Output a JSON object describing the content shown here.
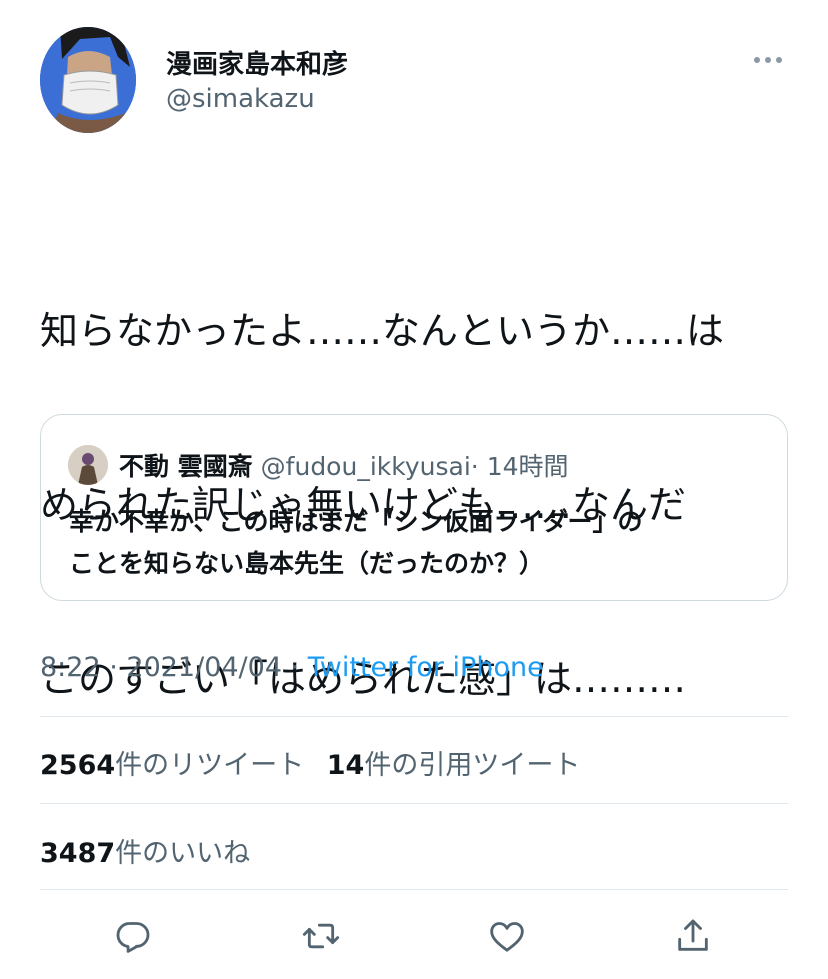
{
  "author": {
    "name": "漫画家島本和彦",
    "handle": "@simakazu"
  },
  "tweet": {
    "text_lines": [
      "知らなかったよ……なんというか……は",
      "められた訳じゃ無いけども……なんだ",
      "このすごい「はめられた感」は………"
    ]
  },
  "quote": {
    "name": "不動 雲國斎",
    "handle": "@fudou_ikkyusai",
    "separator": "·",
    "time": "14時間",
    "text_lines": [
      "幸か不幸か、この時はまだ「シン仮面ライダー」の",
      "ことを知らない島本先生（だったのか？）"
    ]
  },
  "meta": {
    "time": "8:22",
    "date": "2021/04/04",
    "sep": " · ",
    "source": "Twitter for iPhone"
  },
  "stats": {
    "retweets_count": "2564",
    "retweets_label": "件のリツイート",
    "quotes_count": "14",
    "quotes_label": "件の引用ツイート",
    "likes_count": "3487",
    "likes_label": "件のいいね"
  },
  "icons": {
    "more": "more-icon",
    "reply": "reply-icon",
    "retweet": "retweet-icon",
    "like": "heart-icon",
    "share": "share-icon"
  },
  "colors": {
    "accent": "#1d9bf0",
    "secondary_text": "#536471",
    "divider": "#e1e8ed",
    "avatar_bg": "#3b6fd6"
  }
}
